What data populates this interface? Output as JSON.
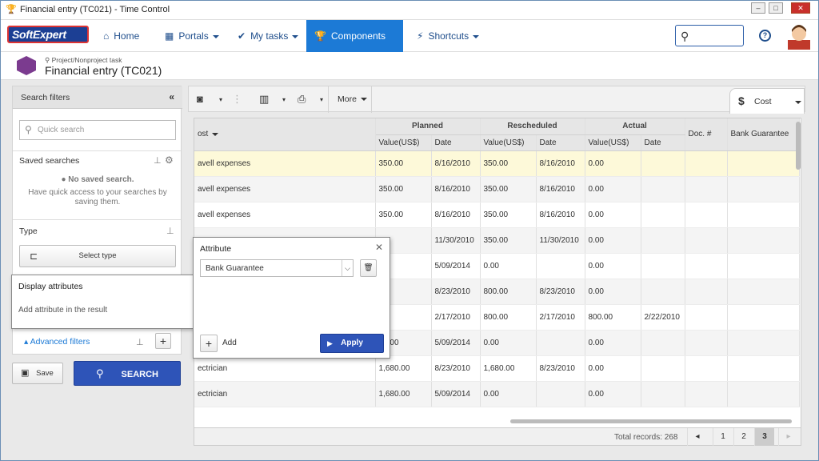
{
  "window": {
    "title": "Financial entry (TC021) - Time Control"
  },
  "nav": {
    "logo": "SoftExpert",
    "items": [
      {
        "label": "Home",
        "icon": "home-icon"
      },
      {
        "label": "Portals",
        "icon": "portals-icon"
      },
      {
        "label": "My tasks",
        "icon": "check-icon"
      },
      {
        "label": "Components",
        "icon": "trophy-icon",
        "active": true
      },
      {
        "label": "Shortcuts",
        "icon": "lightning-icon"
      }
    ],
    "help": "?"
  },
  "breadcrumb": {
    "subtitle": "Project/Nonproject task",
    "title": "Financial entry (TC021)"
  },
  "sidebar": {
    "search_filters": "Search filters",
    "quick_search_placeholder": "Quick search",
    "saved_searches": "Saved searches",
    "no_saved": "No saved search.",
    "no_saved_hint": "Have quick access to your searches by saving them.",
    "type": "Type",
    "select_type": "Select type",
    "advanced_filters": "Advanced filters",
    "save": "Save",
    "search": "SEARCH"
  },
  "display_attributes": {
    "title": "Display attributes",
    "hint": "Add attribute in the result"
  },
  "attribute_popup": {
    "title": "Attribute",
    "selected": "Bank Guarantee",
    "add": "Add",
    "apply": "Apply"
  },
  "toolbar": {
    "more": "More",
    "cost_tab": "Cost"
  },
  "grid": {
    "groups": [
      "Planned",
      "Rescheduled",
      "Actual"
    ],
    "col_cost": "ost",
    "subcols": [
      "Value(US$)",
      "Date",
      "Value(US$)",
      "Date",
      "Value(US$)",
      "Date"
    ],
    "col_doc": "Doc. #",
    "col_bank": "Bank Guarantee",
    "rows": [
      {
        "cost": "avell expenses",
        "pv": "350.00",
        "pd": "8/16/2010",
        "rv": "350.00",
        "rd": "8/16/2010",
        "av": "0.00",
        "ad": "",
        "hl": true
      },
      {
        "cost": "avell expenses",
        "pv": "350.00",
        "pd": "8/16/2010",
        "rv": "350.00",
        "rd": "8/16/2010",
        "av": "0.00",
        "ad": ""
      },
      {
        "cost": "avell expenses",
        "pv": "350.00",
        "pd": "8/16/2010",
        "rv": "350.00",
        "rd": "8/16/2010",
        "av": "0.00",
        "ad": ""
      },
      {
        "cost": "",
        "pv": "",
        "pd": "11/30/2010",
        "rv": "350.00",
        "rd": "11/30/2010",
        "av": "0.00",
        "ad": ""
      },
      {
        "cost": "",
        "pv": "",
        "pd": "5/09/2014",
        "rv": "0.00",
        "rd": "",
        "av": "0.00",
        "ad": ""
      },
      {
        "cost": "",
        "pv": "",
        "pd": "8/23/2010",
        "rv": "800.00",
        "rd": "8/23/2010",
        "av": "0.00",
        "ad": ""
      },
      {
        "cost": "",
        "pv": ".0",
        "pd": "2/17/2010",
        "rv": "800.00",
        "rd": "2/17/2010",
        "av": "800.00",
        "ad": "2/22/2010"
      },
      {
        "cost": "",
        "pv": "80.00",
        "pd": "5/09/2014",
        "rv": "0.00",
        "rd": "",
        "av": "0.00",
        "ad": ""
      },
      {
        "cost": "ectrician",
        "pv": "1,680.00",
        "pd": "8/23/2010",
        "rv": "1,680.00",
        "rd": "8/23/2010",
        "av": "0.00",
        "ad": ""
      },
      {
        "cost": "ectrician",
        "pv": "1,680.00",
        "pd": "5/09/2014",
        "rv": "0.00",
        "rd": "",
        "av": "0.00",
        "ad": ""
      }
    ]
  },
  "footer": {
    "total": "Total records: 268",
    "pages": [
      "1",
      "2",
      "3"
    ],
    "current": "3"
  }
}
